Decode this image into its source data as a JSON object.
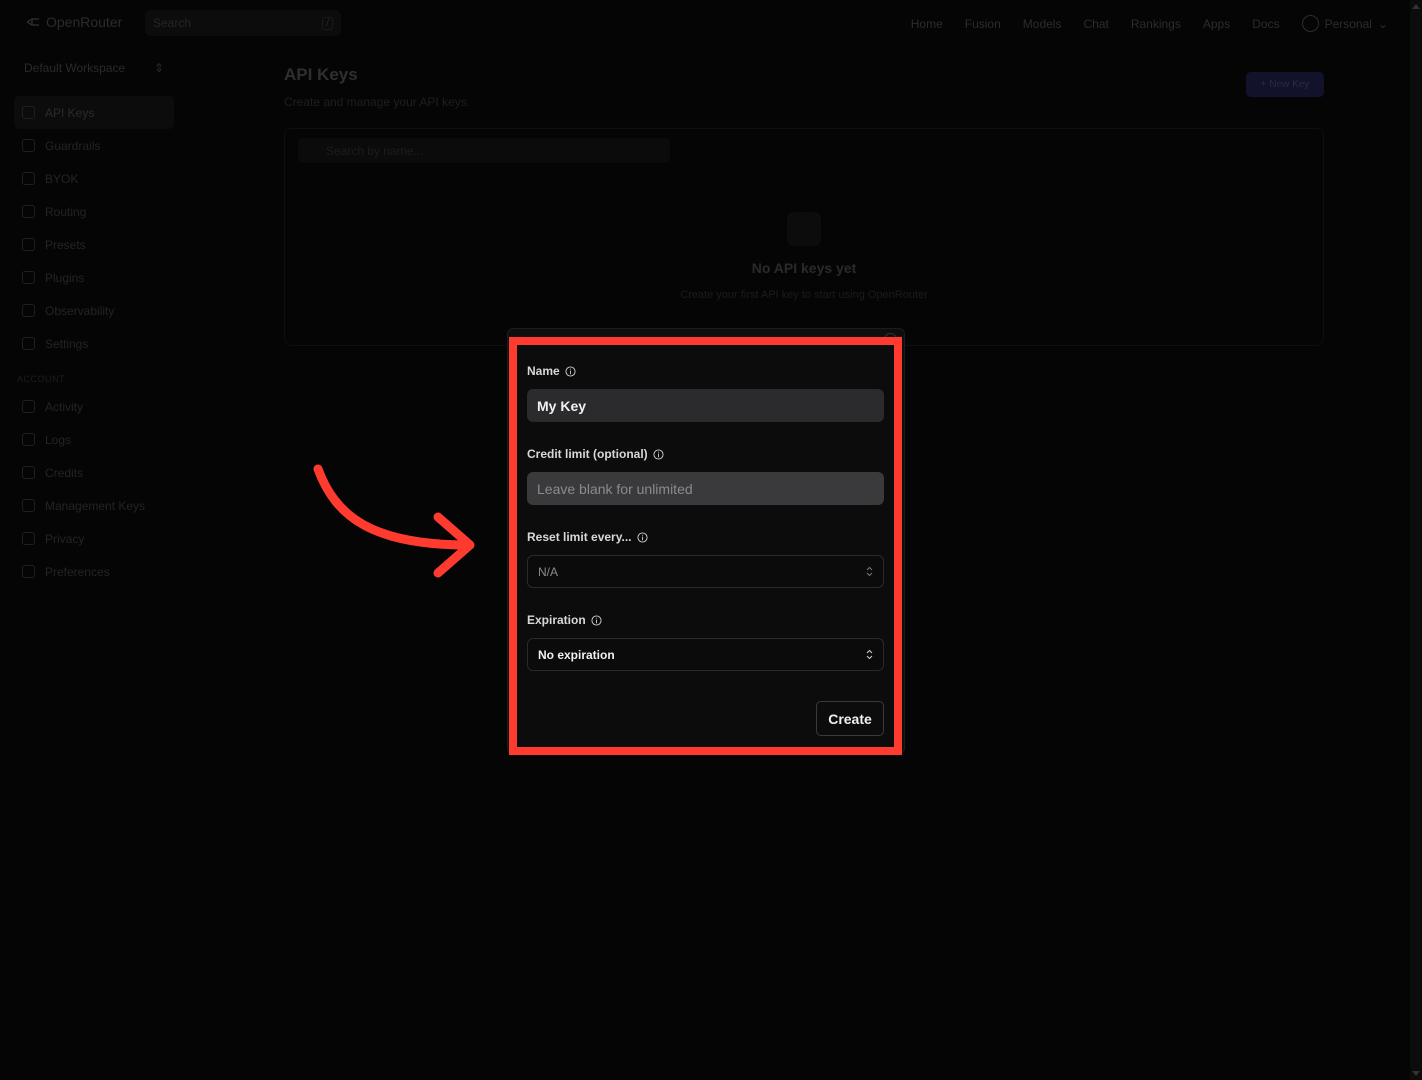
{
  "topnav": {
    "brand": "OpenRouter",
    "search_placeholder": "Search",
    "search_shortcut": "/",
    "links": [
      "Home",
      "Fusion",
      "Models",
      "Chat",
      "Rankings",
      "Apps",
      "Docs"
    ],
    "account": "Personal"
  },
  "sidebar": {
    "workspace": "Default Workspace",
    "items": [
      "API Keys",
      "Guardrails",
      "BYOK",
      "Routing",
      "Presets",
      "Plugins",
      "Observability",
      "Settings"
    ],
    "account_heading": "ACCOUNT",
    "account_items": [
      "Activity",
      "Logs",
      "Credits",
      "Management Keys",
      "Privacy",
      "Preferences"
    ]
  },
  "main": {
    "title": "API Keys",
    "subtitle": "Create and manage your API keys.",
    "new_key_button": "+ New Key",
    "search_placeholder": "Search by name...",
    "empty_title": "No API keys yet",
    "empty_subtitle": "Create your first API key to start using OpenRouter"
  },
  "modal": {
    "name_label": "Name",
    "name_value": "My Key",
    "credit_label": "Credit limit (optional)",
    "credit_placeholder": "Leave blank for unlimited",
    "reset_label": "Reset limit every...",
    "reset_value": "N/A",
    "expiration_label": "Expiration",
    "expiration_value": "No expiration",
    "create_button": "Create"
  },
  "colors": {
    "highlight": "#ff3b2f",
    "background": "#050505",
    "input_bg": "#2b2b2d"
  }
}
